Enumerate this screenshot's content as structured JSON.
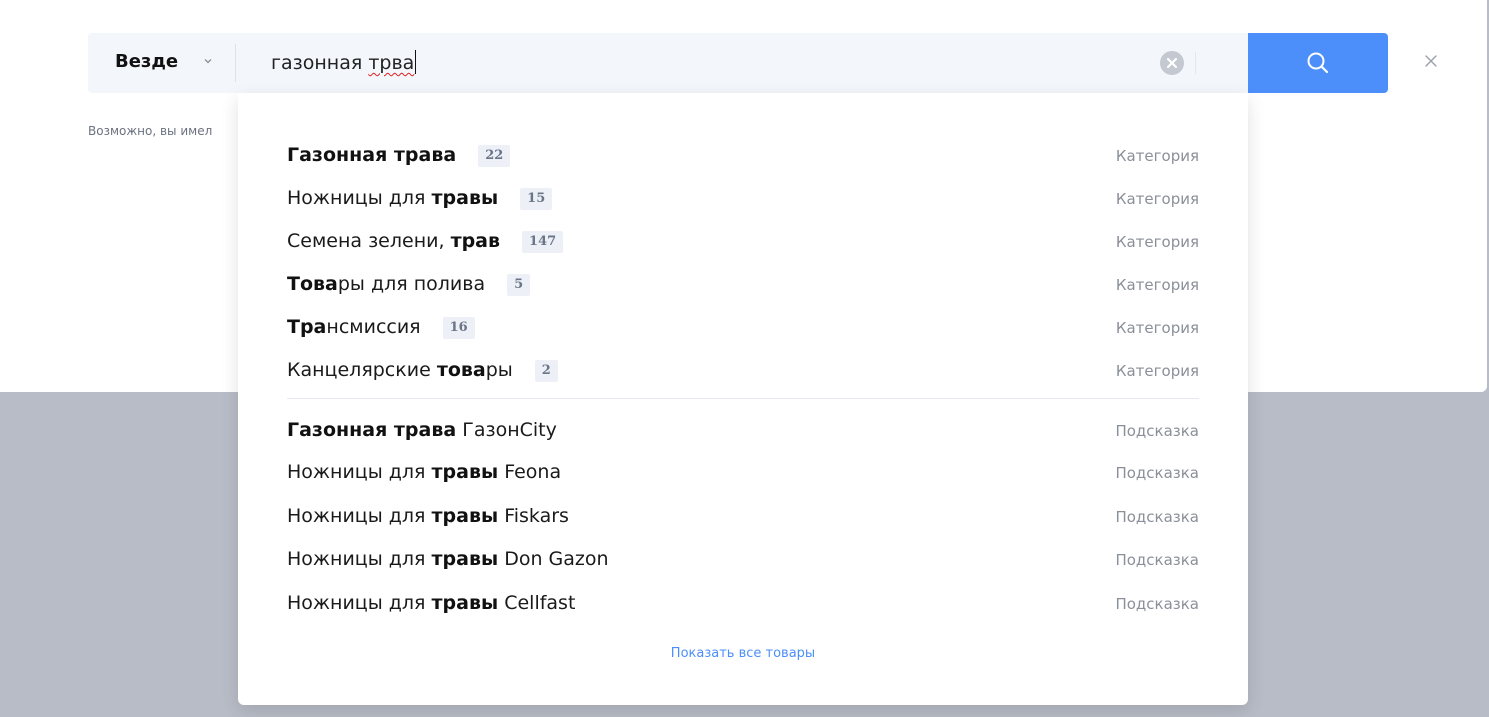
{
  "search": {
    "scope_label": "Везде",
    "query_prefix": "газонная ",
    "query_typo": "трва",
    "hint_text": "Возможно, вы имел"
  },
  "dropdown": {
    "categories": [
      {
        "label": [
          {
            "text": "Газонная трава",
            "bold": true
          }
        ],
        "count": "22",
        "type": "Категория"
      },
      {
        "label": [
          {
            "text": "Ножницы для ",
            "bold": false
          },
          {
            "text": "травы",
            "bold": true
          }
        ],
        "count": "15",
        "type": "Категория"
      },
      {
        "label": [
          {
            "text": "Семена зелени, ",
            "bold": false
          },
          {
            "text": "трав",
            "bold": true
          }
        ],
        "count": "147",
        "type": "Категория"
      },
      {
        "label": [
          {
            "text": "Това",
            "bold": true
          },
          {
            "text": "ры для полива",
            "bold": false
          }
        ],
        "count": "5",
        "type": "Категория"
      },
      {
        "label": [
          {
            "text": "Тра",
            "bold": true
          },
          {
            "text": "нсмиссия",
            "bold": false
          }
        ],
        "count": "16",
        "type": "Категория"
      },
      {
        "label": [
          {
            "text": "Канцелярские ",
            "bold": false
          },
          {
            "text": "това",
            "bold": true
          },
          {
            "text": "ры",
            "bold": false
          }
        ],
        "count": "2",
        "type": "Категория"
      }
    ],
    "suggestions": [
      {
        "label": [
          {
            "text": "Газонная трава",
            "bold": true
          },
          {
            "text": " ГазонCity",
            "bold": false
          }
        ],
        "type": "Подсказка"
      },
      {
        "label": [
          {
            "text": "Ножницы для ",
            "bold": false
          },
          {
            "text": "травы",
            "bold": true
          },
          {
            "text": " Feona",
            "bold": false
          }
        ],
        "type": "Подсказка"
      },
      {
        "label": [
          {
            "text": "Ножницы для ",
            "bold": false
          },
          {
            "text": "травы",
            "bold": true
          },
          {
            "text": " Fiskars",
            "bold": false
          }
        ],
        "type": "Подсказка"
      },
      {
        "label": [
          {
            "text": "Ножницы для ",
            "bold": false
          },
          {
            "text": "травы",
            "bold": true
          },
          {
            "text": " Don Gazon",
            "bold": false
          }
        ],
        "type": "Подсказка"
      },
      {
        "label": [
          {
            "text": "Ножницы для ",
            "bold": false
          },
          {
            "text": "травы",
            "bold": true
          },
          {
            "text": " Cellfast",
            "bold": false
          }
        ],
        "type": "Подсказка"
      }
    ],
    "show_all_label": "Показать все товары"
  },
  "colors": {
    "accent": "#4d8ffa",
    "backdrop": "#b8bcc6",
    "search_bg": "#f3f6fb"
  },
  "icons": {
    "scope": "chevron-down-icon",
    "clear": "clear-circle-icon",
    "search": "search-icon",
    "close": "close-icon"
  }
}
